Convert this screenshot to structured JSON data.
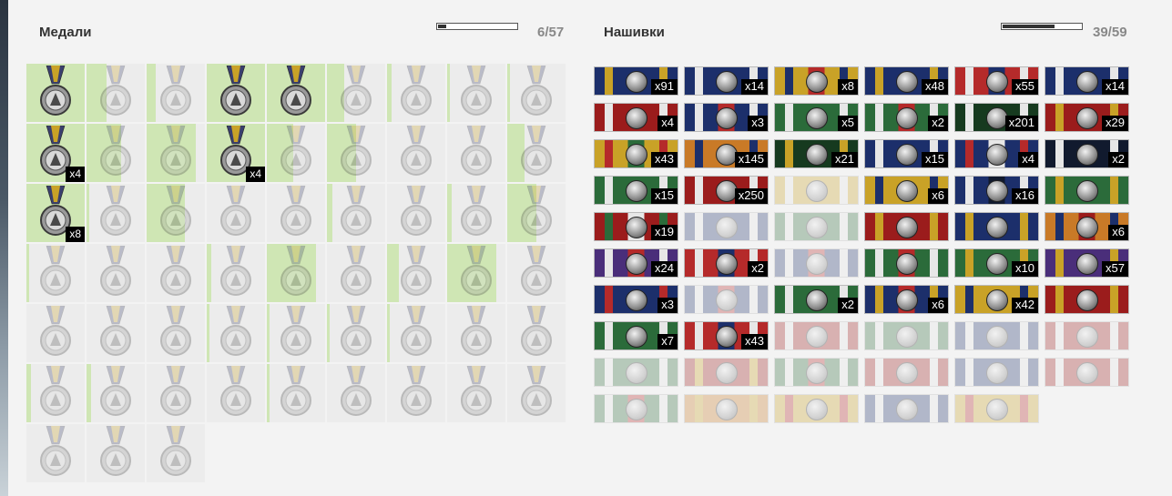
{
  "medals": {
    "title": "Медали",
    "counter": "6/57",
    "progress": 0.105,
    "items": [
      {
        "earned": true,
        "progress": 1,
        "count": ""
      },
      {
        "earned": false,
        "progress": 0.35,
        "count": ""
      },
      {
        "earned": false,
        "progress": 0.15,
        "count": ""
      },
      {
        "earned": true,
        "progress": 1,
        "count": ""
      },
      {
        "earned": true,
        "progress": 1,
        "count": ""
      },
      {
        "earned": false,
        "progress": 0.3,
        "count": ""
      },
      {
        "earned": false,
        "progress": 0.08,
        "count": ""
      },
      {
        "earned": false,
        "progress": 0.05,
        "count": ""
      },
      {
        "earned": false,
        "progress": 0.05,
        "count": ""
      },
      {
        "earned": true,
        "progress": 1,
        "count": "x4"
      },
      {
        "earned": false,
        "progress": 0.6,
        "count": ""
      },
      {
        "earned": false,
        "progress": 0.85,
        "count": ""
      },
      {
        "earned": true,
        "progress": 1,
        "count": "x4"
      },
      {
        "earned": false,
        "progress": 0.45,
        "count": ""
      },
      {
        "earned": false,
        "progress": 0.5,
        "count": ""
      },
      {
        "earned": false,
        "progress": 0,
        "count": ""
      },
      {
        "earned": false,
        "progress": 0,
        "count": ""
      },
      {
        "earned": false,
        "progress": 0.3,
        "count": ""
      },
      {
        "earned": true,
        "progress": 1,
        "count": "x8"
      },
      {
        "earned": false,
        "progress": 0.05,
        "count": ""
      },
      {
        "earned": false,
        "progress": 0.65,
        "count": ""
      },
      {
        "earned": false,
        "progress": 0,
        "count": ""
      },
      {
        "earned": false,
        "progress": 0,
        "count": ""
      },
      {
        "earned": false,
        "progress": 0.1,
        "count": ""
      },
      {
        "earned": false,
        "progress": 0,
        "count": ""
      },
      {
        "earned": false,
        "progress": 0.08,
        "count": ""
      },
      {
        "earned": false,
        "progress": 0.5,
        "count": ""
      },
      {
        "earned": false,
        "progress": 0.05,
        "count": ""
      },
      {
        "earned": false,
        "progress": 0,
        "count": ""
      },
      {
        "earned": false,
        "progress": 0,
        "count": ""
      },
      {
        "earned": false,
        "progress": 0.08,
        "count": ""
      },
      {
        "earned": false,
        "progress": 0.85,
        "count": ""
      },
      {
        "earned": false,
        "progress": 0,
        "count": ""
      },
      {
        "earned": false,
        "progress": 0.2,
        "count": ""
      },
      {
        "earned": false,
        "progress": 0.85,
        "count": ""
      },
      {
        "earned": false,
        "progress": 0,
        "count": ""
      },
      {
        "earned": false,
        "progress": 0,
        "count": ""
      },
      {
        "earned": false,
        "progress": 0,
        "count": ""
      },
      {
        "earned": false,
        "progress": 0,
        "count": ""
      },
      {
        "earned": false,
        "progress": 0.05,
        "count": ""
      },
      {
        "earned": false,
        "progress": 0.05,
        "count": ""
      },
      {
        "earned": false,
        "progress": 0.05,
        "count": ""
      },
      {
        "earned": false,
        "progress": 0.05,
        "count": ""
      },
      {
        "earned": false,
        "progress": 0,
        "count": ""
      },
      {
        "earned": false,
        "progress": 0,
        "count": ""
      },
      {
        "earned": false,
        "progress": 0.08,
        "count": ""
      },
      {
        "earned": false,
        "progress": 0.08,
        "count": ""
      },
      {
        "earned": false,
        "progress": 0,
        "count": ""
      },
      {
        "earned": false,
        "progress": 0,
        "count": ""
      },
      {
        "earned": false,
        "progress": 0.05,
        "count": ""
      },
      {
        "earned": false,
        "progress": 0,
        "count": ""
      },
      {
        "earned": false,
        "progress": 0,
        "count": ""
      },
      {
        "earned": false,
        "progress": 0,
        "count": ""
      },
      {
        "earned": false,
        "progress": 0,
        "count": ""
      },
      {
        "earned": false,
        "progress": 0,
        "count": ""
      },
      {
        "earned": false,
        "progress": 0,
        "count": ""
      },
      {
        "earned": false,
        "progress": 0,
        "count": ""
      }
    ]
  },
  "ribbons": {
    "title": "Нашивки",
    "counter": "39/59",
    "progress": 0.66,
    "items": [
      {
        "earned": true,
        "count": "x91",
        "colors": [
          "#1c2f6b",
          "#c9a227",
          "#1c2f6b"
        ]
      },
      {
        "earned": true,
        "count": "x14",
        "colors": [
          "#1c2f6b",
          "#e7e7e7",
          "#1c2f6b"
        ]
      },
      {
        "earned": true,
        "count": "x8",
        "colors": [
          "#c9a227",
          "#1c2f6b",
          "#b52a2a"
        ]
      },
      {
        "earned": true,
        "count": "x48",
        "colors": [
          "#1c2f6b",
          "#c9a227",
          "#1c2f6b"
        ]
      },
      {
        "earned": true,
        "count": "x55",
        "colors": [
          "#b52a2a",
          "#e7e7e7",
          "#1c2f6b"
        ]
      },
      {
        "earned": true,
        "count": "x14",
        "colors": [
          "#1c2f6b",
          "#e7e7e7",
          "#1c2f6b"
        ]
      },
      {
        "earned": true,
        "count": "x4",
        "colors": [
          "#9b1c1c",
          "#e7e7e7",
          "#9b1c1c"
        ]
      },
      {
        "earned": true,
        "count": "x3",
        "colors": [
          "#1c2f6b",
          "#e7e7e7",
          "#b52a2a"
        ]
      },
      {
        "earned": true,
        "count": "x5",
        "colors": [
          "#2b6b3a",
          "#e7e7e7",
          "#2b6b3a"
        ]
      },
      {
        "earned": true,
        "count": "x2",
        "colors": [
          "#2b6b3a",
          "#e7e7e7",
          "#b52a2a"
        ]
      },
      {
        "earned": true,
        "count": "x201",
        "colors": [
          "#163a1f",
          "#e7e7e7",
          "#163a1f"
        ]
      },
      {
        "earned": true,
        "count": "x29",
        "colors": [
          "#9b1c1c",
          "#c9a227",
          "#9b1c1c"
        ]
      },
      {
        "earned": true,
        "count": "x43",
        "colors": [
          "#c9a227",
          "#b52a2a",
          "#2b6b3a"
        ]
      },
      {
        "earned": true,
        "count": "x145",
        "colors": [
          "#c97a27",
          "#1c2f6b",
          "#c97a27"
        ]
      },
      {
        "earned": true,
        "count": "x21",
        "colors": [
          "#163a1f",
          "#c9a227",
          "#163a1f"
        ]
      },
      {
        "earned": true,
        "count": "x15",
        "colors": [
          "#1c2f6b",
          "#e7e7e7",
          "#1c2f6b"
        ]
      },
      {
        "earned": true,
        "count": "x4",
        "colors": [
          "#1c2f6b",
          "#b52a2a",
          "#e7e7e7"
        ]
      },
      {
        "earned": true,
        "count": "x2",
        "colors": [
          "#111a2e",
          "#e7e7e7",
          "#111a2e"
        ]
      },
      {
        "earned": true,
        "count": "x15",
        "colors": [
          "#2b6b3a",
          "#e7e7e7",
          "#2b6b3a"
        ]
      },
      {
        "earned": true,
        "count": "x250",
        "colors": [
          "#9b1c1c",
          "#e7e7e7",
          "#9b1c1c"
        ]
      },
      {
        "earned": false,
        "count": "",
        "colors": [
          "#c9a227",
          "#e7e7e7",
          "#c9a227"
        ]
      },
      {
        "earned": true,
        "count": "x6",
        "colors": [
          "#c9a227",
          "#1c2f6b",
          "#c9a227"
        ]
      },
      {
        "earned": true,
        "count": "x16",
        "colors": [
          "#1c2f6b",
          "#e7e7e7",
          "#111a2e"
        ]
      },
      {
        "earned": true,
        "count": "",
        "colors": [
          "#2b6b3a",
          "#c9a227",
          "#2b6b3a"
        ]
      },
      {
        "earned": true,
        "count": "x19",
        "colors": [
          "#9b1c1c",
          "#2b6b3a",
          "#e7e7e7"
        ]
      },
      {
        "earned": false,
        "count": "",
        "colors": [
          "#1c2f6b",
          "#e7e7e7",
          "#1c2f6b"
        ]
      },
      {
        "earned": false,
        "count": "",
        "colors": [
          "#2b6b3a",
          "#e7e7e7",
          "#2b6b3a"
        ]
      },
      {
        "earned": true,
        "count": "",
        "colors": [
          "#9b1c1c",
          "#c9a227",
          "#9b1c1c"
        ]
      },
      {
        "earned": true,
        "count": "",
        "colors": [
          "#1c2f6b",
          "#c9a227",
          "#1c2f6b"
        ]
      },
      {
        "earned": true,
        "count": "x6",
        "colors": [
          "#c97a27",
          "#1c2f6b",
          "#9b1c1c"
        ]
      },
      {
        "earned": true,
        "count": "x24",
        "colors": [
          "#4a2e7a",
          "#e7e7e7",
          "#b52a2a"
        ]
      },
      {
        "earned": true,
        "count": "x2",
        "colors": [
          "#b52a2a",
          "#e7e7e7",
          "#1c2f6b"
        ]
      },
      {
        "earned": false,
        "count": "",
        "colors": [
          "#1c2f6b",
          "#e7e7e7",
          "#b52a2a"
        ]
      },
      {
        "earned": true,
        "count": "",
        "colors": [
          "#2b6b3a",
          "#e7e7e7",
          "#b52a2a"
        ]
      },
      {
        "earned": true,
        "count": "x10",
        "colors": [
          "#2b6b3a",
          "#c9a227",
          "#2b6b3a"
        ]
      },
      {
        "earned": true,
        "count": "x57",
        "colors": [
          "#4a2e7a",
          "#c9a227",
          "#4a2e7a"
        ]
      },
      {
        "earned": true,
        "count": "x3",
        "colors": [
          "#1c2f6b",
          "#b52a2a",
          "#1c2f6b"
        ]
      },
      {
        "earned": false,
        "count": "",
        "colors": [
          "#1c2f6b",
          "#e7e7e7",
          "#b52a2a"
        ]
      },
      {
        "earned": true,
        "count": "x2",
        "colors": [
          "#2b6b3a",
          "#e7e7e7",
          "#2b6b3a"
        ]
      },
      {
        "earned": true,
        "count": "x6",
        "colors": [
          "#1c2f6b",
          "#c9a227",
          "#b52a2a"
        ]
      },
      {
        "earned": true,
        "count": "x42",
        "colors": [
          "#c9a227",
          "#1c2f6b",
          "#c9a227"
        ]
      },
      {
        "earned": true,
        "count": "",
        "colors": [
          "#9b1c1c",
          "#c9a227",
          "#9b1c1c"
        ]
      },
      {
        "earned": true,
        "count": "x7",
        "colors": [
          "#2b6b3a",
          "#e7e7e7",
          "#2b6b3a"
        ]
      },
      {
        "earned": true,
        "count": "x43",
        "colors": [
          "#b52a2a",
          "#e7e7e7",
          "#1c2f6b"
        ]
      },
      {
        "earned": false,
        "count": "",
        "colors": [
          "#9b1c1c",
          "#e7e7e7",
          "#9b1c1c"
        ]
      },
      {
        "earned": false,
        "count": "",
        "colors": [
          "#2b6b3a",
          "#e7e7e7",
          "#2b6b3a"
        ]
      },
      {
        "earned": false,
        "count": "",
        "colors": [
          "#1c2f6b",
          "#e7e7e7",
          "#1c2f6b"
        ]
      },
      {
        "earned": false,
        "count": "",
        "colors": [
          "#9b1c1c",
          "#e7e7e7",
          "#9b1c1c"
        ]
      },
      {
        "earned": false,
        "count": "",
        "colors": [
          "#2b6b3a",
          "#e7e7e7",
          "#2b6b3a"
        ]
      },
      {
        "earned": false,
        "count": "",
        "colors": [
          "#9b1c1c",
          "#c9a227",
          "#9b1c1c"
        ]
      },
      {
        "earned": false,
        "count": "",
        "colors": [
          "#2b6b3a",
          "#e7e7e7",
          "#b52a2a"
        ]
      },
      {
        "earned": false,
        "count": "",
        "colors": [
          "#9b1c1c",
          "#e7e7e7",
          "#9b1c1c"
        ]
      },
      {
        "earned": false,
        "count": "",
        "colors": [
          "#1c2f6b",
          "#e7e7e7",
          "#1c2f6b"
        ]
      },
      {
        "earned": false,
        "count": "",
        "colors": [
          "#9b1c1c",
          "#e7e7e7",
          "#9b1c1c"
        ]
      },
      {
        "earned": false,
        "count": "",
        "colors": [
          "#2b6b3a",
          "#e7e7e7",
          "#b52a2a"
        ]
      },
      {
        "earned": false,
        "count": "",
        "colors": [
          "#c97a27",
          "#c9a227",
          "#c97a27"
        ]
      },
      {
        "earned": false,
        "count": "",
        "colors": [
          "#c9a227",
          "#b52a2a",
          "#c9a227"
        ]
      },
      {
        "earned": false,
        "count": "",
        "colors": [
          "#1c2f6b",
          "#e7e7e7",
          "#1c2f6b"
        ]
      },
      {
        "earned": false,
        "count": "",
        "colors": [
          "#c9a227",
          "#b52a2a",
          "#c9a227"
        ]
      }
    ]
  },
  "colors": {
    "progress_fill": "#cfe6b4",
    "badge_bg": "#000000",
    "badge_text": "#ffffff"
  }
}
